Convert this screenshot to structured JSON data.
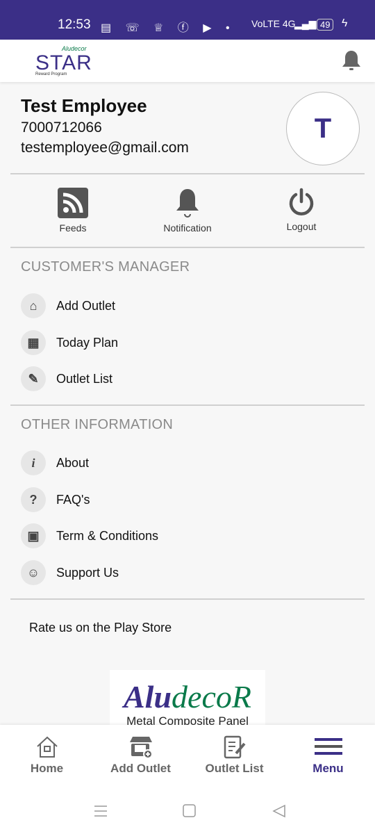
{
  "status_bar": {
    "time": "12:53",
    "notification_icons": [
      "news-icon",
      "missed-call-icon",
      "trophy-icon",
      "facebook-icon",
      "youtube-icon",
      "dot-icon"
    ],
    "network": "VoLTE 4G",
    "battery": "49",
    "charging": true
  },
  "header": {
    "logo_text": "STAR",
    "logo_brand": "Aludecor",
    "logo_tagline": "Reward Program"
  },
  "profile": {
    "name": "Test Employee",
    "phone": "7000712066",
    "email": "testemployee@gmail.com",
    "avatar_initial": "T"
  },
  "quick_actions": [
    {
      "label": "Feeds",
      "icon": "rss-icon"
    },
    {
      "label": "Notification",
      "icon": "bell-icon"
    },
    {
      "label": "Logout",
      "icon": "power-icon"
    }
  ],
  "sections": [
    {
      "title": "CUSTOMER'S MANAGER",
      "items": [
        {
          "label": "Add Outlet",
          "icon": "store-add-icon"
        },
        {
          "label": "Today Plan",
          "icon": "calendar-icon"
        },
        {
          "label": "Outlet List",
          "icon": "list-edit-icon"
        }
      ]
    },
    {
      "title": "OTHER INFORMATION",
      "items": [
        {
          "label": "About",
          "icon": "info-icon"
        },
        {
          "label": "FAQ's",
          "icon": "question-icon"
        },
        {
          "label": "Term & Conditions",
          "icon": "clipboard-shield-icon"
        },
        {
          "label": "Support Us",
          "icon": "support-agent-icon"
        }
      ]
    }
  ],
  "rate_us": "Rate us on the Play Store",
  "footer_logo": {
    "brand_part1": "Alu",
    "brand_part2": "decoR",
    "tagline": "Metal Composite Panel"
  },
  "bottom_nav": [
    {
      "label": "Home",
      "icon": "home-icon"
    },
    {
      "label": "Add Outlet",
      "icon": "store-add-icon"
    },
    {
      "label": "Outlet List",
      "icon": "list-edit-icon"
    },
    {
      "label": "Menu",
      "icon": "menu-icon",
      "active": true
    }
  ],
  "colors": {
    "primary": "#3b2f87",
    "green": "#0a7a4a",
    "icon_gray": "#555555"
  }
}
